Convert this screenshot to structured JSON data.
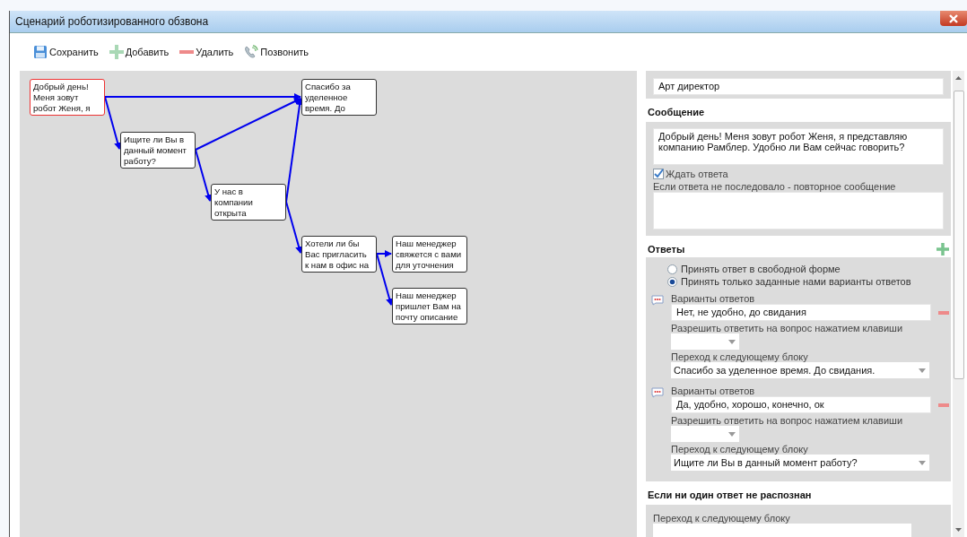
{
  "window": {
    "title": "Сценарий роботизированного обзвона"
  },
  "toolbar": [
    {
      "kind": "save",
      "label": "Сохранить"
    },
    {
      "kind": "add",
      "label": "Добавить"
    },
    {
      "kind": "delete",
      "label": "Удалить"
    },
    {
      "kind": "call",
      "label": "Позвонить"
    }
  ],
  "diagram": {
    "nodes": [
      {
        "text": "Добрый день!\nМеня зовут\nробот Женя, я",
        "selected": true
      },
      {
        "text": "Ищите ли Вы в\nданный момент\nработу?",
        "selected": false
      },
      {
        "text": "Спасибо за\nуделенное\nвремя. До",
        "selected": false
      },
      {
        "text": "У нас в\nкомпании\nоткрыта",
        "selected": false
      },
      {
        "text": "Хотели ли бы\nВас пригласить\nк нам в офис на",
        "selected": false
      },
      {
        "text": "Наш менеджер\nсвяжется с вами\nдля уточнения",
        "selected": false
      },
      {
        "text": "Наш менеджер\nпришлет Вам на\nпочту описание",
        "selected": false
      }
    ]
  },
  "panel": {
    "script_name": {
      "value": "Арт директор"
    },
    "message": {
      "heading": "Сообщение",
      "value": "Добрый день! Меня зовут робот Женя, я представляю компанию Рамблер. Удобно ли Вам сейчас говорить?",
      "wait_for_answer": {
        "label": "Ждать ответа",
        "checked": true
      },
      "repeat_label": "Если ответа не последовало - повторное сообщение"
    },
    "answers": {
      "heading": "Ответы",
      "modes": [
        {
          "label": "Принять ответ в свободной форме",
          "selected": false
        },
        {
          "label": "Принять только заданные нами варианты ответов",
          "selected": true
        }
      ],
      "variants": [
        {
          "label": "Варианты ответов",
          "value": "Нет, не удобно, до свидания",
          "key_label": "Разрешить ответить на вопрос нажатием клавиши",
          "next_label": "Переход к следующему блоку",
          "next_value": "Спасибо за уделенное время. До свидания."
        },
        {
          "label": "Варианты ответов",
          "value": "Да, удобно, хорошо, конечно, ок",
          "key_label": "Разрешить ответить на вопрос нажатием клавиши",
          "next_label": "Переход к следующему блоку",
          "next_value": "Ищите ли Вы в данный момент работу?"
        }
      ]
    },
    "fallback": {
      "heading": "Если ни один ответ не распознан",
      "next_label": "Переход к следующему блоку"
    }
  }
}
